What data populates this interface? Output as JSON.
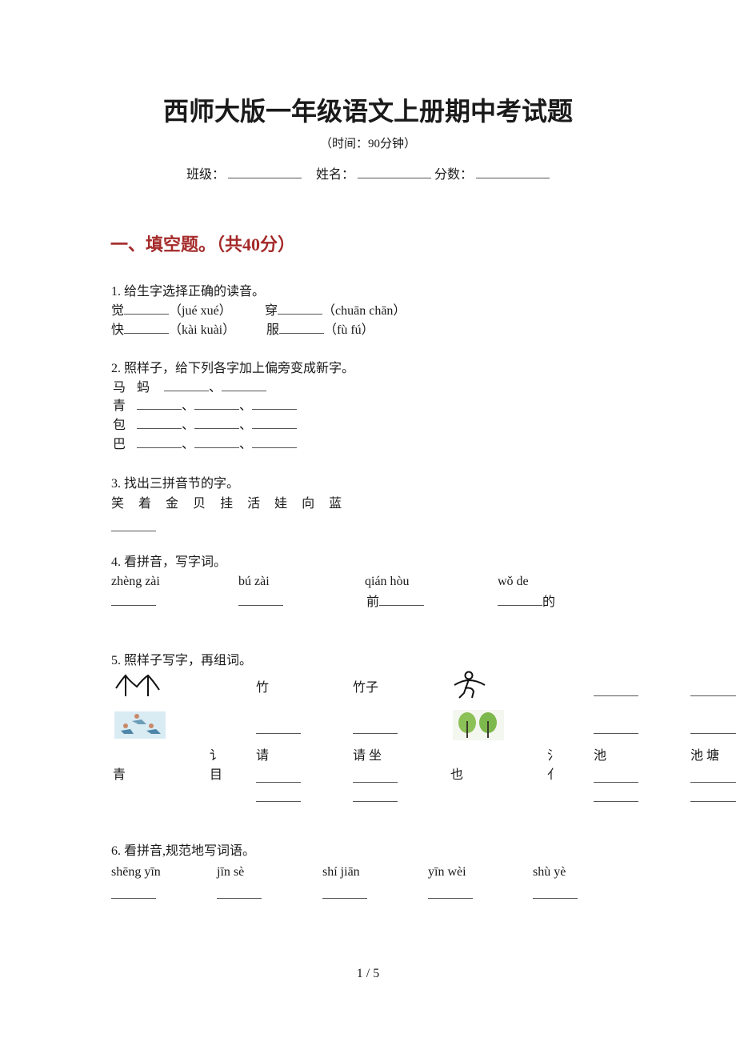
{
  "header": {
    "title": "西师大版一年级语文上册期中考试题",
    "time": "（时间：90分钟）",
    "class_label": "班级：",
    "name_label": "姓名：",
    "score_label": "分数："
  },
  "section1": {
    "title": "一、填空题。（共40分）"
  },
  "q1": {
    "prompt": "1. 给生字选择正确的读音。",
    "items": [
      {
        "char": "觉",
        "options": "（jué  xué）"
      },
      {
        "char": "穿",
        "options": "（chuān  chān）"
      },
      {
        "char": "快",
        "options": "（kài  kuài）"
      },
      {
        "char": "服",
        "options": "（fù  fú）"
      }
    ]
  },
  "q2": {
    "prompt": "2. 照样子，给下列各字加上偏旁变成新字。",
    "rows": [
      {
        "base": "马",
        "example": "蚂",
        "sep": "、"
      },
      {
        "base": "青",
        "sep": "、"
      },
      {
        "base": "包",
        "sep": "、"
      },
      {
        "base": "巴",
        "sep": "、"
      }
    ]
  },
  "q3": {
    "prompt": "3. 找出三拼音节的字。",
    "chars": [
      "笑",
      "着",
      "金",
      "贝",
      "挂",
      "活",
      "娃",
      "向",
      "蓝"
    ]
  },
  "q4": {
    "prompt": "4. 看拼音，写字词。",
    "items": [
      {
        "pinyin": "zhèng  zài",
        "prefix": "",
        "suffix": ""
      },
      {
        "pinyin": "bú  zài",
        "prefix": "",
        "suffix": ""
      },
      {
        "pinyin": "qián  hòu",
        "prefix": "前",
        "suffix": ""
      },
      {
        "pinyin": "wǒ  de",
        "prefix": "",
        "suffix": "的"
      }
    ]
  },
  "q5": {
    "prompt": "5. 照样子写字，再组词。",
    "example_char": "竹",
    "example_word": "竹子",
    "pictures": [
      "bamboo-pictograph",
      "people-running-picture",
      "person-pictograph",
      "trees-picture"
    ],
    "left_group": {
      "base": "青",
      "radical_top": "讠",
      "radical_bottom": "目",
      "char": "请",
      "word": "请 坐"
    },
    "right_group": {
      "base": "也",
      "radical_top": "氵",
      "radical_bottom": "亻",
      "char": "池",
      "word": "池 塘"
    }
  },
  "q6": {
    "prompt": "6. 看拼音,规范地写词语。",
    "pinyin": [
      "shēng yīn",
      "jīn sè",
      "shí jiān",
      "yīn wèi",
      "shù yè"
    ]
  },
  "footer": {
    "page": "1 / 5"
  }
}
